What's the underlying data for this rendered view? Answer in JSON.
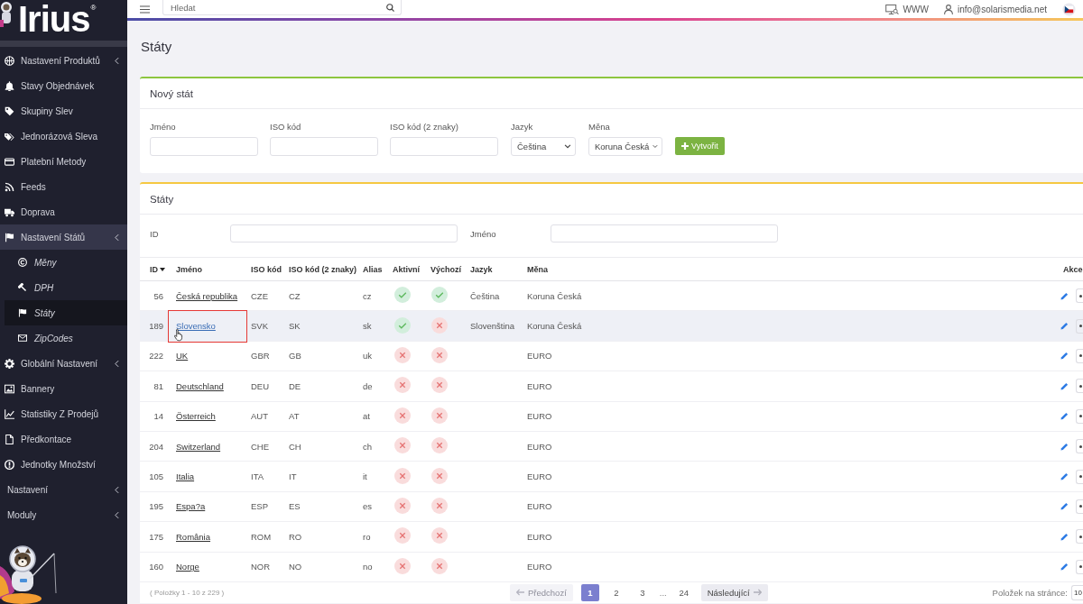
{
  "logo": {
    "text": "Irius",
    "mark": "®"
  },
  "sidebar": {
    "items": [
      {
        "label": "Nastavení Produktů",
        "kind": "link",
        "expanded": false,
        "selected": false
      },
      {
        "label": "Stavy Objednávek",
        "kind": "link",
        "selected": false
      },
      {
        "label": "Skupiny Slev",
        "kind": "link",
        "selected": false
      },
      {
        "label": "Jednorázová Sleva",
        "kind": "link",
        "selected": false
      },
      {
        "label": "Platební Metody",
        "kind": "link",
        "selected": false
      },
      {
        "label": "Feeds",
        "kind": "link",
        "selected": false
      },
      {
        "label": "Doprava",
        "kind": "link",
        "selected": false
      },
      {
        "label": "Nastavení Států",
        "kind": "link",
        "expanded": true,
        "selected": false,
        "children": [
          {
            "label": "Měny",
            "selected": false
          },
          {
            "label": "DPH",
            "selected": false
          },
          {
            "label": "Státy",
            "selected": true
          },
          {
            "label": "ZipCodes",
            "selected": false
          }
        ]
      },
      {
        "label": "Globální Nastavení",
        "kind": "link",
        "expanded": false,
        "selected": false
      },
      {
        "label": "Bannery",
        "kind": "link",
        "selected": false
      },
      {
        "label": "Statistiky Z Prodejů",
        "kind": "link",
        "selected": false
      },
      {
        "label": "Předkontace",
        "kind": "link",
        "selected": false
      },
      {
        "label": "Jednotky Množství",
        "kind": "link",
        "selected": false
      },
      {
        "label": "Nastavení",
        "kind": "group",
        "expanded": false,
        "selected": false
      },
      {
        "label": "Moduly",
        "kind": "group",
        "expanded": false,
        "selected": false
      }
    ]
  },
  "topbar": {
    "search": {
      "placeholder": "Hledat"
    },
    "links": [
      {
        "label": "WWW"
      },
      {
        "label": "info@solarismedia.net"
      }
    ]
  },
  "page_title": "Státy",
  "new_country": {
    "title": "Nový stát",
    "fields": [
      {
        "label": "Jméno",
        "kind": "input"
      },
      {
        "label": "ISO kód",
        "kind": "input"
      },
      {
        "label": "ISO kód (2 znaky)",
        "kind": "input"
      },
      {
        "label": "Jazyk",
        "kind": "select",
        "value": "Čeština"
      },
      {
        "label": "Měna",
        "kind": "select",
        "value": "Koruna Česká"
      }
    ],
    "button": "Vytvořit"
  },
  "countries": {
    "title": "Státy",
    "filters": [
      {
        "label": "ID"
      },
      {
        "label": "Jméno"
      }
    ],
    "table": {
      "columns": [
        {
          "label": "ID",
          "sorted": true
        },
        {
          "label": "Jméno",
          "sorted": false
        },
        {
          "label": "ISO kód",
          "sorted": false
        },
        {
          "label": "ISO kód (2 znaky)",
          "sorted": false
        },
        {
          "label": "Alias",
          "sorted": false
        },
        {
          "label": "Aktivní",
          "sorted": false
        },
        {
          "label": "Výchozí",
          "sorted": false
        },
        {
          "label": "Jazyk",
          "sorted": false
        },
        {
          "label": "Měna",
          "sorted": false
        },
        {
          "label": "Akce",
          "sorted": false
        }
      ],
      "rows": [
        {
          "id": "56",
          "name": "Česká republika",
          "iso3": "CZE",
          "iso2": "CZ",
          "alias": "cz",
          "active": true,
          "default": true,
          "language": "Čeština",
          "currency": "Koruna Česká",
          "hovered": false,
          "marked": false
        },
        {
          "id": "189",
          "name": "Slovensko",
          "iso3": "SVK",
          "iso2": "SK",
          "alias": "sk",
          "active": true,
          "default": false,
          "language": "Slovenština",
          "currency": "Koruna Česká",
          "hovered": true,
          "marked": true
        },
        {
          "id": "222",
          "name": "UK",
          "iso3": "GBR",
          "iso2": "GB",
          "alias": "uk",
          "active": false,
          "default": false,
          "currency": "EURO",
          "hovered": false,
          "marked": false
        },
        {
          "id": "81",
          "name": "Deutschland",
          "iso3": "DEU",
          "iso2": "DE",
          "alias": "de",
          "active": false,
          "default": false,
          "currency": "EURO",
          "hovered": false,
          "marked": false
        },
        {
          "id": "14",
          "name": "Österreich",
          "iso3": "AUT",
          "iso2": "AT",
          "alias": "at",
          "active": false,
          "default": false,
          "currency": "EURO",
          "hovered": false,
          "marked": false
        },
        {
          "id": "204",
          "name": "Switzerland",
          "iso3": "CHE",
          "iso2": "CH",
          "alias": "ch",
          "active": false,
          "default": false,
          "currency": "EURO",
          "hovered": false,
          "marked": false
        },
        {
          "id": "105",
          "name": "Italia",
          "iso3": "ITA",
          "iso2": "IT",
          "alias": "it",
          "active": false,
          "default": false,
          "currency": "EURO",
          "hovered": false,
          "marked": false
        },
        {
          "id": "195",
          "name": "Espa?a",
          "iso3": "ESP",
          "iso2": "ES",
          "alias": "es",
          "active": false,
          "default": false,
          "currency": "EURO",
          "hovered": false,
          "marked": false
        },
        {
          "id": "175",
          "name": "România",
          "iso3": "ROM",
          "iso2": "RO",
          "alias": "ro",
          "active": false,
          "default": false,
          "currency": "EURO",
          "hovered": false,
          "marked": false
        },
        {
          "id": "160",
          "name": "Norge",
          "iso3": "NOR",
          "iso2": "NO",
          "alias": "no",
          "active": false,
          "default": false,
          "currency": "EURO",
          "hovered": false,
          "marked": false
        }
      ]
    },
    "summary": "( Položky 1 - 10 z 229 )",
    "pagination": {
      "prev": {
        "label": "Předchozí",
        "disabled": true
      },
      "pages": [
        {
          "label": "1",
          "kind": "page",
          "selected": true
        },
        {
          "label": "2",
          "kind": "page",
          "selected": false
        },
        {
          "label": "3",
          "kind": "page",
          "selected": false
        },
        {
          "label": "...",
          "kind": "gap"
        },
        {
          "label": "24",
          "kind": "page",
          "selected": false
        }
      ],
      "next": {
        "label": "Následující",
        "disabled": false
      }
    },
    "per_page": {
      "label": "Položek na stránce:",
      "value": "10"
    }
  }
}
